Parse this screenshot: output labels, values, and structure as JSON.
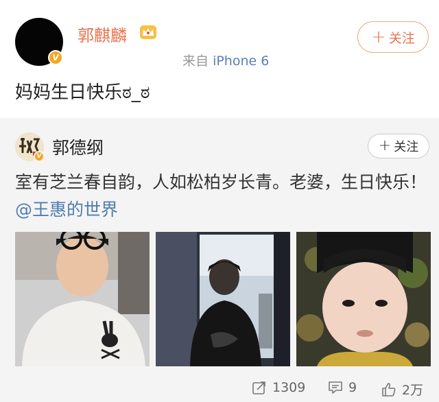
{
  "post": {
    "username": "郭麒麟",
    "source_prefix": "来自",
    "source_device": "iPhone 6",
    "follow_label": "关注",
    "text": "妈妈生日快乐ಠ_ಠ",
    "verified_badge": "V"
  },
  "repost": {
    "username": "郭德纲",
    "follow_label": "关注",
    "text": "室有芝兰春自韵，人如松柏岁长青。老婆，生日快乐！",
    "mention": "@王惠的世界",
    "verified_badge": "V",
    "images": [
      {
        "icon": "photo-young-man"
      },
      {
        "icon": "photo-woman-window"
      },
      {
        "icon": "photo-baby"
      }
    ]
  },
  "actions": {
    "repost_count": "1309",
    "comment_count": "9",
    "like_count": "2万"
  },
  "colors": {
    "accent": "#eb7350",
    "link": "#507daf",
    "vip_badge": "#f6a623",
    "repost_bg": "#f4f4f4"
  },
  "icons": {
    "crown": "crown-icon",
    "repost": "share-icon",
    "comment": "comment-icon",
    "like": "thumbs-up-icon"
  }
}
